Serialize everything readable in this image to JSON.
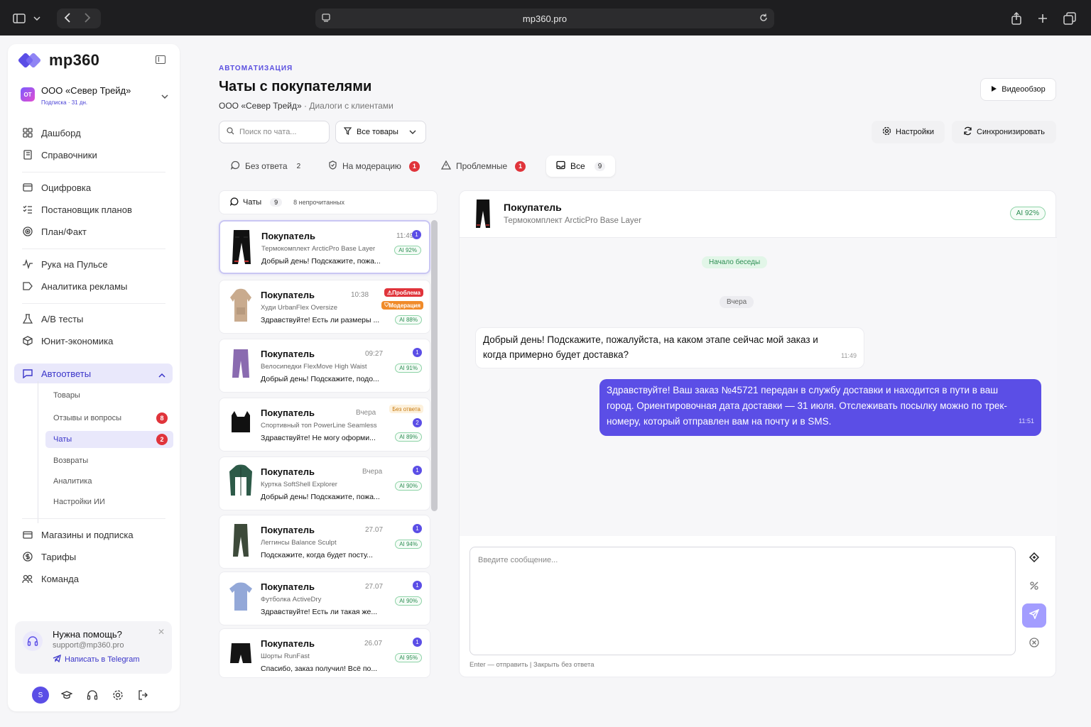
{
  "browser": {
    "url": "mp360.pro"
  },
  "brand": {
    "name": "mp360",
    "accent": "#5b4ee6"
  },
  "org": {
    "initials": "OT",
    "name": "ООО «Север Трейд»",
    "subscription": "Подписка · 31 дн."
  },
  "sidebar": {
    "group1": [
      {
        "label": "Дашборд",
        "icon": "grid-icon"
      },
      {
        "label": "Справочники",
        "icon": "book-icon"
      }
    ],
    "group2": [
      {
        "label": "Оцифровка",
        "icon": "card-icon"
      },
      {
        "label": "Постановщик планов",
        "icon": "list-check-icon"
      },
      {
        "label": "План/Факт",
        "icon": "target-icon"
      }
    ],
    "group3": [
      {
        "label": "Рука на Пульсе",
        "icon": "pulse-icon"
      },
      {
        "label": "Аналитика рекламы",
        "icon": "ad-icon"
      }
    ],
    "group4": [
      {
        "label": "A/B тесты",
        "icon": "flask-icon"
      },
      {
        "label": "Юнит-экономика",
        "icon": "cube-icon"
      }
    ],
    "active": {
      "label": "Автоответы",
      "icon": "chat-icon"
    },
    "subitems": [
      {
        "label": "Товары"
      },
      {
        "label": "Отзывы и вопросы",
        "badge": "8"
      },
      {
        "label": "Чаты",
        "badge": "2"
      },
      {
        "label": "Возвраты"
      },
      {
        "label": "Аналитика"
      },
      {
        "label": "Настройки ИИ"
      }
    ],
    "group5": [
      {
        "label": "Магазины и подписка",
        "icon": "store-icon"
      },
      {
        "label": "Тарифы",
        "icon": "dollar-icon"
      },
      {
        "label": "Команда",
        "icon": "team-icon"
      }
    ]
  },
  "help": {
    "title": "Нужна помощь?",
    "email": "support@mp360.pro",
    "link": "Написать в Telegram"
  },
  "user": {
    "initial": "S"
  },
  "header": {
    "breadcrumb": "АВТОМАТИЗАЦИЯ",
    "title": "Чаты с покупателями",
    "org": "ООО «Север Трейд»",
    "separator": "·",
    "subtitle": "Диалоги с клиентами",
    "video_label": "Видеообзор",
    "settings_label": "Настройки",
    "sync_label": "Синхронизировать"
  },
  "search": {
    "placeholder": "Поиск по чата..."
  },
  "filter": {
    "value": "Все товары"
  },
  "tabs": [
    {
      "label": "Без ответа",
      "count": "2"
    },
    {
      "label": "На модерацию",
      "count": "1"
    },
    {
      "label": "Проблемные",
      "count": "1"
    },
    {
      "label": "Все",
      "count": "9"
    }
  ],
  "list": {
    "title": "Чаты",
    "count": "9",
    "unread": "8 непрочитанных"
  },
  "chats": [
    {
      "who": "Покупатель",
      "time": "11:49",
      "product": "Термокомплект ArcticPro Base Layer",
      "message": "Добрый день! Подскажите, пожа...",
      "unread": "1",
      "ai": "AI 92%"
    },
    {
      "who": "Покупатель",
      "time": "10:38",
      "product": "Худи UrbanFlex Oversize",
      "message": "Здравствуйте! Есть ли размеры ...",
      "ai": "AI 88%",
      "tag1": "Проблема",
      "tag2": "Модерация"
    },
    {
      "who": "Покупатель",
      "time": "09:27",
      "product": "Велосипедки FlexMove High Waist",
      "message": "Добрый день! Подскажите, подо...",
      "unread": "1",
      "ai": "AI 91%"
    },
    {
      "who": "Покупатель",
      "time": "Вчера",
      "product": "Спортивный топ PowerLine Seamless",
      "message": "Здравствуйте! Не могу оформи...",
      "unread": "2",
      "ai": "AI 89%",
      "tag": "Без ответа"
    },
    {
      "who": "Покупатель",
      "time": "Вчера",
      "product": "Куртка SoftShell Explorer",
      "message": "Добрый день! Подскажите, пожа...",
      "unread": "1",
      "ai": "AI 90%"
    },
    {
      "who": "Покупатель",
      "time": "27.07",
      "product": "Леггинсы Balance Sculpt",
      "message": "Подскажите, когда будет посту...",
      "unread": "1",
      "ai": "AI 94%"
    },
    {
      "who": "Покупатель",
      "time": "27.07",
      "product": "Футболка ActiveDry",
      "message": "Здравствуйте! Есть ли такая же...",
      "unread": "1",
      "ai": "AI 90%"
    },
    {
      "who": "Покупатель",
      "time": "26.07",
      "product": "Шорты RunFast",
      "message": "Спасибо, заказ получил! Всё по...",
      "unread": "1",
      "ai": "AI 95%"
    }
  ],
  "conversation": {
    "who": "Покупатель",
    "product": "Термокомплект ArcticPro Base Layer",
    "ai": "AI 92%",
    "start": "Начало беседы",
    "day": "Вчера",
    "incoming": {
      "text": "Добрый день! Подскажите, пожалуйста, на каком этапе сейчас мой заказ и когда примерно будет доставка?",
      "time": "11:49"
    },
    "outgoing": {
      "text": "Здравствуйте! Ваш заказ №45721 передан в службу доставки и находится в пути в ваш город. Ориентировочная дата доставки — 31 июля. Отслеживать посылку можно по трек-номеру, который отправлен вам на почту и в SMS.",
      "time": "11:51"
    },
    "composer_placeholder": "Введите сообщение...",
    "hint": "Enter — отправить | Закрыть без ответа"
  }
}
